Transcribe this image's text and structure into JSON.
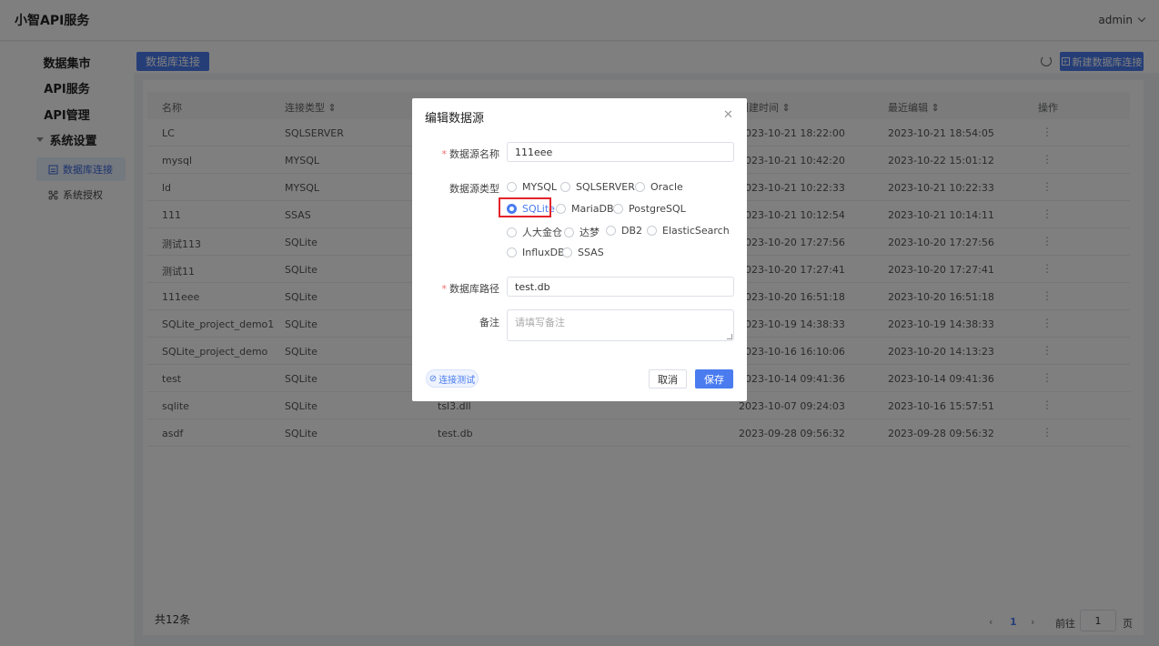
{
  "app": {
    "title": "小智API服务",
    "user": "admin"
  },
  "sidebar": {
    "items": [
      {
        "label": "数据集市"
      },
      {
        "label": "API服务"
      },
      {
        "label": "API管理"
      },
      {
        "label": "系统设置"
      }
    ],
    "subitems": [
      {
        "label": "数据库连接",
        "icon": "database-icon",
        "active": true
      },
      {
        "label": "系统授权",
        "icon": "network-icon",
        "active": false
      }
    ]
  },
  "main": {
    "tab": "数据库连接",
    "new_button": "新建数据库连接",
    "columns": [
      "名称",
      "连接类型",
      "",
      "创建时间",
      "最近编辑",
      "操作"
    ],
    "rows": [
      {
        "name": "LC",
        "type": "SQLSERVER",
        "path": "",
        "created": "2023-10-21 18:22:00",
        "edited": "2023-10-21 18:54:05"
      },
      {
        "name": "mysql",
        "type": "MYSQL",
        "path": "",
        "created": "2023-10-21 10:42:20",
        "edited": "2023-10-22 15:01:12"
      },
      {
        "name": "ld",
        "type": "MYSQL",
        "path": "",
        "created": "2023-10-21 10:22:33",
        "edited": "2023-10-21 10:22:33"
      },
      {
        "name": "111",
        "type": "SSAS",
        "path": "",
        "created": "2023-10-21 10:12:54",
        "edited": "2023-10-21 10:14:11"
      },
      {
        "name": "测试113",
        "type": "SQLite",
        "path": "",
        "created": "2023-10-20 17:27:56",
        "edited": "2023-10-20 17:27:56"
      },
      {
        "name": "测试11",
        "type": "SQLite",
        "path": "",
        "created": "2023-10-20 17:27:41",
        "edited": "2023-10-20 17:27:41"
      },
      {
        "name": "111eee",
        "type": "SQLite",
        "path": "",
        "created": "2023-10-20 16:51:18",
        "edited": "2023-10-20 16:51:18"
      },
      {
        "name": "SQLite_project_demo1",
        "type": "SQLite",
        "path": "",
        "created": "2023-10-19 14:38:33",
        "edited": "2023-10-19 14:38:33"
      },
      {
        "name": "SQLite_project_demo",
        "type": "SQLite",
        "path": "",
        "created": "2023-10-16 16:10:06",
        "edited": "2023-10-20 14:13:23"
      },
      {
        "name": "test",
        "type": "SQLite",
        "path": "",
        "created": "2023-10-14 09:41:36",
        "edited": "2023-10-14 09:41:36"
      },
      {
        "name": "sqlite",
        "type": "SQLite",
        "path": "tsl3.dll",
        "created": "2023-10-07 09:24:03",
        "edited": "2023-10-16 15:57:51"
      },
      {
        "name": "asdf",
        "type": "SQLite",
        "path": "test.db",
        "created": "2023-09-28 09:56:32",
        "edited": "2023-09-28 09:56:32"
      }
    ],
    "total": "共12条",
    "page": "1",
    "goto_label": "前往",
    "goto_value": "1",
    "page_suffix": "页"
  },
  "dialog": {
    "title": "编辑数据源",
    "name_label": "数据源名称",
    "name_value": "111eee",
    "type_label": "数据源类型",
    "types": [
      "MYSQL",
      "SQLSERVER",
      "Oracle",
      "SQLite",
      "MariaDB",
      "PostgreSQL",
      "人大金仓",
      "达梦",
      "DB2",
      "ElasticSearch",
      "InfluxDB",
      "SSAS"
    ],
    "selected_type": "SQLite",
    "path_label": "数据库路径",
    "path_value": "test.db",
    "note_label": "备注",
    "note_placeholder": "请填写备注",
    "test_button": "连接测试",
    "cancel_button": "取消",
    "save_button": "保存"
  },
  "colors": {
    "accent": "#4a7cf0",
    "required": "#f56c6c",
    "highlight": "#e3232a"
  }
}
